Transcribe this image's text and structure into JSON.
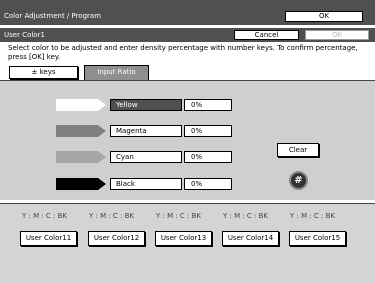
{
  "header": {
    "title": "Color Adjustment / Program",
    "ok_label": "OK"
  },
  "subheader": {
    "title": "User Color1",
    "cancel_label": "Cancel",
    "ok_label": "OK"
  },
  "instruction": "Select color to be adjusted and enter density percentage with number keys.  To confirm percentage, press [OK] key.",
  "tabs": [
    {
      "label": "± keys",
      "active": false
    },
    {
      "label": "Input Ratio",
      "active": true
    }
  ],
  "colors": [
    {
      "name": "Yellow",
      "value": "0%",
      "swatch": "#ffffff",
      "selected": true
    },
    {
      "name": "Magenta",
      "value": "0%",
      "swatch": "#808080",
      "selected": false
    },
    {
      "name": "Cyan",
      "value": "0%",
      "swatch": "#a6a6a6",
      "selected": false
    },
    {
      "name": "Black",
      "value": "0%",
      "swatch": "#000000",
      "selected": false
    }
  ],
  "clear_label": "Clear",
  "hash_label": "#",
  "user_colors": [
    {
      "ymc": "Y : M : C : BK",
      "label": "User Color11"
    },
    {
      "ymc": "Y : M : C : BK",
      "label": "User Color12"
    },
    {
      "ymc": "Y : M : C : BK",
      "label": "User Color13"
    },
    {
      "ymc": "Y : M : C : BK",
      "label": "User Color14"
    },
    {
      "ymc": "Y : M : C : BK",
      "label": "User Color15"
    }
  ],
  "theme": {
    "bar": "#505050",
    "panel": "#cfcfcf",
    "bottom_panel": "#d4d4d4"
  }
}
